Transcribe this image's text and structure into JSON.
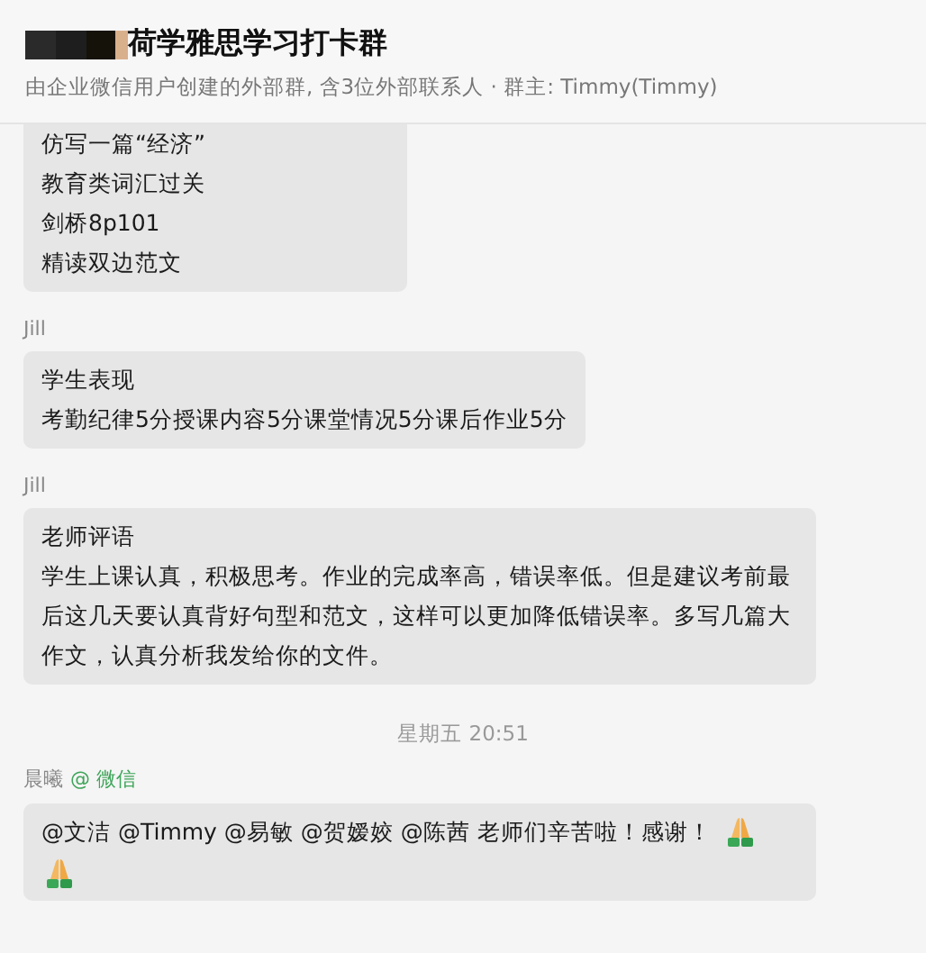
{
  "header": {
    "title": "荷学雅思学习打卡群",
    "subtitle": "由企业微信用户创建的外部群, 含3位外部联系人 · 群主: Timmy(Timmy)"
  },
  "messages": [
    {
      "kind": "message",
      "lines": [
        "仿写一篇“经济”",
        "教育类词汇过关",
        "剑桥8p101",
        "精读双边范文"
      ]
    },
    {
      "kind": "message",
      "sender": "Jill",
      "lines": [
        "学生表现",
        "考勤纪律5分授课内容5分课堂情况5分课后作业5分"
      ]
    },
    {
      "kind": "message",
      "sender": "Jill",
      "lines": [
        "老师评语",
        "学生上课认真，积极思考。作业的完成率高，错误率低。但是建议考前最后这几天要认真背好句型和范文，这样可以更加降低错误率。多写几篇大作文，认真分析我发给你的文件。"
      ]
    },
    {
      "kind": "time",
      "text": "星期五 20:51"
    },
    {
      "kind": "message",
      "sender": "晨曦",
      "sender_tag": "@ 微信",
      "segments": [
        {
          "kind": "text",
          "text": "@文洁 @Timmy @易敏 @贺嫒姣 @陈茜  老师们辛苦啦！感谢！"
        },
        {
          "kind": "emoji"
        },
        {
          "kind": "emoji"
        }
      ]
    }
  ]
}
